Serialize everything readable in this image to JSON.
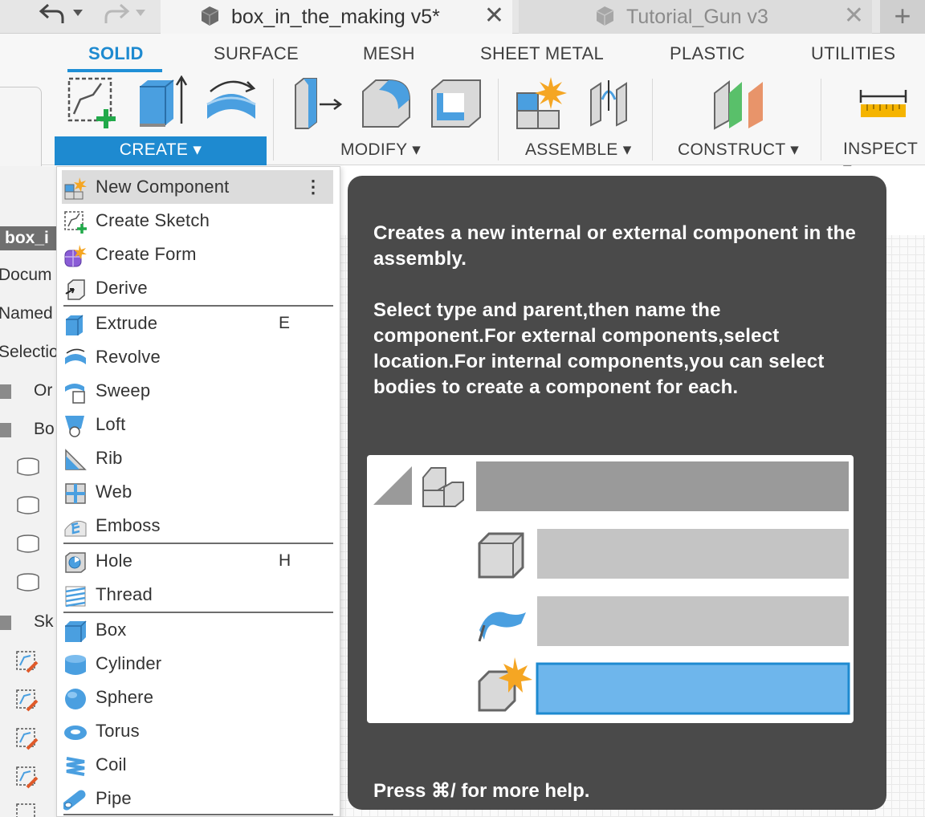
{
  "tabbar": {
    "undo_icon": "undo-icon",
    "redo_icon": "redo-icon",
    "active_tab_title": "box_in_the_making v5*",
    "inactive_tab_title": "Tutorial_Gun v3",
    "close_glyph": "✕",
    "new_tab_glyph": "+"
  },
  "workspace_tabs": [
    "SOLID",
    "SURFACE",
    "MESH",
    "SHEET METAL",
    "PLASTIC",
    "UTILITIES"
  ],
  "tool_groups": {
    "create": "CREATE",
    "modify": "MODIFY",
    "assemble": "ASSEMBLE",
    "construct": "CONSTRUCT",
    "inspect": "INSPECT"
  },
  "dropdown_arrow": "▾",
  "colors": {
    "accent": "#1e8ad0",
    "tooltip_bg": "#4a4a4a",
    "menu_hover": "#dcdcdc",
    "icon_blue": "#4a9fe0",
    "star_orange": "#f5a623"
  },
  "browser": {
    "header": "box_i",
    "items": [
      "Docum",
      "Named",
      "Selectio",
      "Or",
      "Bo",
      "Sk"
    ]
  },
  "create_menu": {
    "more_glyph": "⋮",
    "items": [
      {
        "label": "New Component",
        "icon": "new-component-icon",
        "shortcut": ""
      },
      {
        "label": "Create Sketch",
        "icon": "create-sketch-icon",
        "shortcut": ""
      },
      {
        "label": "Create Form",
        "icon": "create-form-icon",
        "shortcut": ""
      },
      {
        "label": "Derive",
        "icon": "derive-icon",
        "shortcut": ""
      },
      {
        "label": "Extrude",
        "icon": "extrude-icon",
        "shortcut": "E"
      },
      {
        "label": "Revolve",
        "icon": "revolve-icon",
        "shortcut": ""
      },
      {
        "label": "Sweep",
        "icon": "sweep-icon",
        "shortcut": ""
      },
      {
        "label": "Loft",
        "icon": "loft-icon",
        "shortcut": ""
      },
      {
        "label": "Rib",
        "icon": "rib-icon",
        "shortcut": ""
      },
      {
        "label": "Web",
        "icon": "web-icon",
        "shortcut": ""
      },
      {
        "label": "Emboss",
        "icon": "emboss-icon",
        "shortcut": ""
      },
      {
        "label": "Hole",
        "icon": "hole-icon",
        "shortcut": "H"
      },
      {
        "label": "Thread",
        "icon": "thread-icon",
        "shortcut": ""
      },
      {
        "label": "Box",
        "icon": "box-icon",
        "shortcut": ""
      },
      {
        "label": "Cylinder",
        "icon": "cylinder-icon",
        "shortcut": ""
      },
      {
        "label": "Sphere",
        "icon": "sphere-icon",
        "shortcut": ""
      },
      {
        "label": "Torus",
        "icon": "torus-icon",
        "shortcut": ""
      },
      {
        "label": "Coil",
        "icon": "coil-icon",
        "shortcut": ""
      },
      {
        "label": "Pipe",
        "icon": "pipe-icon",
        "shortcut": ""
      }
    ]
  },
  "tooltip": {
    "summary": "Creates a new internal or external component in the assembly.",
    "detail": "Select type and parent,then name the component.For external components,select location.For internal components,you can select bodies to create a component for each.",
    "footer": "Press ⌘/ for more help."
  }
}
